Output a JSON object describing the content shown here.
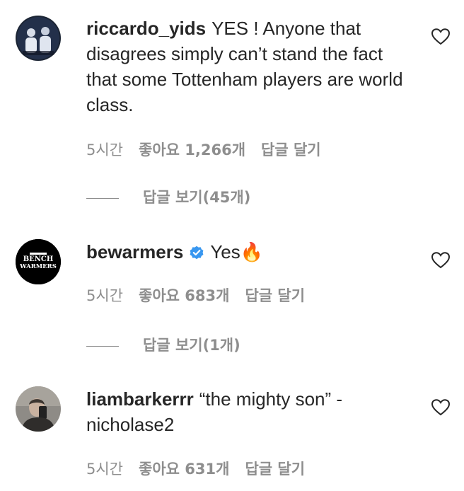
{
  "comments": [
    {
      "username": "riccardo_yids",
      "verified": false,
      "text": "YES ! Anyone that disagrees simply can’t stand the fact that some Tottenham players are world class.",
      "time": "5시간",
      "likes": "좋아요 1,266개",
      "reply_label": "답글 달기",
      "view_replies": "답글 보기(45개)"
    },
    {
      "username": "bewarmers",
      "verified": true,
      "text": "Yes🔥",
      "avatar_text": [
        "BENCH",
        "WARMERS"
      ],
      "time": "5시간",
      "likes": "좋아요 683개",
      "reply_label": "답글 달기",
      "view_replies": "답글 보기(1개)"
    },
    {
      "username": "liambarkerrr",
      "verified": false,
      "text": "“the mighty son” - nicholase2",
      "time": "5시간",
      "likes": "좋아요 631개",
      "reply_label": "답글 달기"
    }
  ],
  "colors": {
    "text": "#262626",
    "secondary": "#8e8e8e",
    "verified": "#3897f0"
  },
  "icons": {
    "like": "heart-outline-icon",
    "verified": "verified-badge-icon"
  }
}
